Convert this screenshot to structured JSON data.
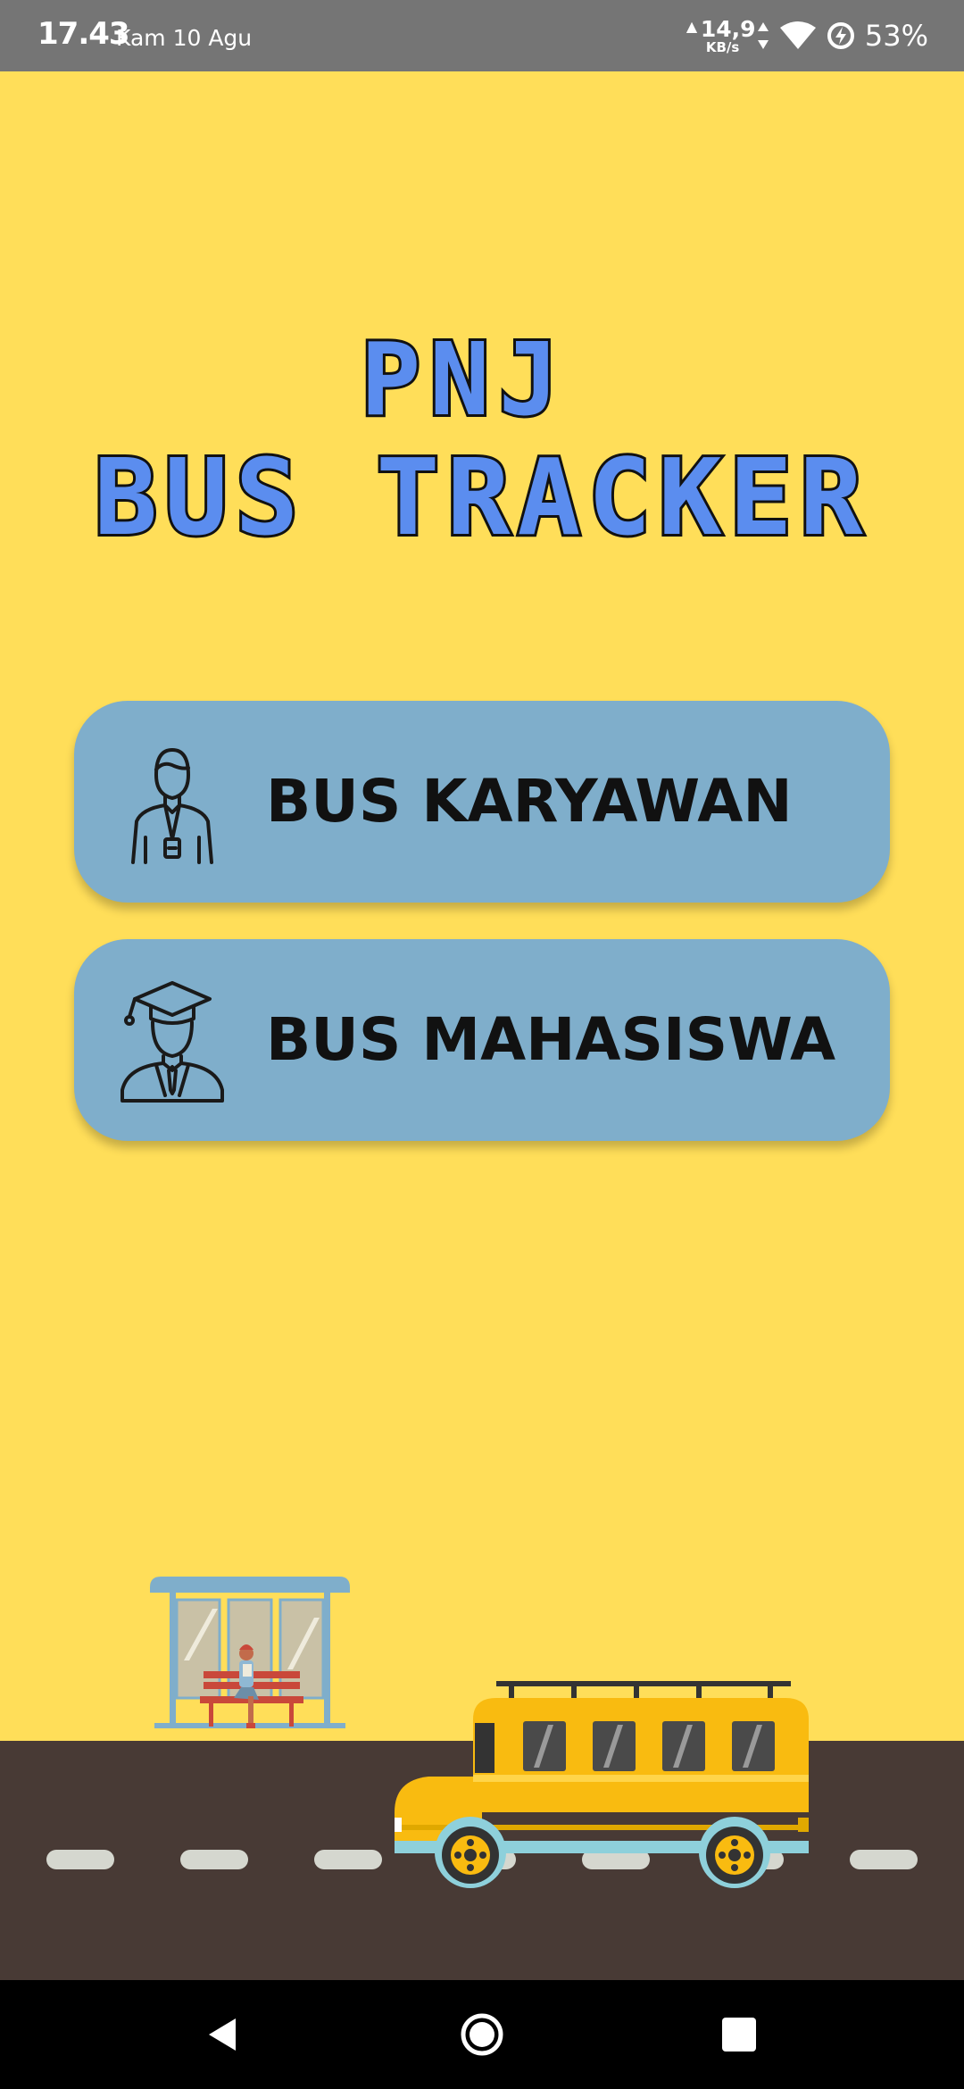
{
  "status_bar": {
    "time": "17.43",
    "date": "Kam 10 Agu",
    "net_speed_value": "14,9",
    "net_speed_unit": "KB/s",
    "battery_percent": "53%",
    "icons": [
      "upload-arrow-icon",
      "data-activity-icon",
      "wifi-icon",
      "battery-saver-icon"
    ]
  },
  "title": {
    "line1": "PNJ",
    "line2": "BUS TRACKER"
  },
  "menu": {
    "karyawan": {
      "label": "BUS KARYAWAN",
      "icon": "employee-icon"
    },
    "mahasiswa": {
      "label": "BUS MAHASISWA",
      "icon": "graduate-student-icon"
    }
  },
  "scene": {
    "elements": [
      "bus-stop-shelter",
      "person-on-bench",
      "road",
      "school-bus"
    ]
  },
  "nav_bar": {
    "buttons": [
      "back-icon",
      "home-icon",
      "recents-icon"
    ]
  },
  "colors": {
    "background": "#FFDE59",
    "button": "#7FAECB",
    "title_fill": "#5B8DEF",
    "title_outline": "#111111",
    "road": "#483A35",
    "bus_body": "#F9BB10",
    "status_bar": "#757575"
  }
}
